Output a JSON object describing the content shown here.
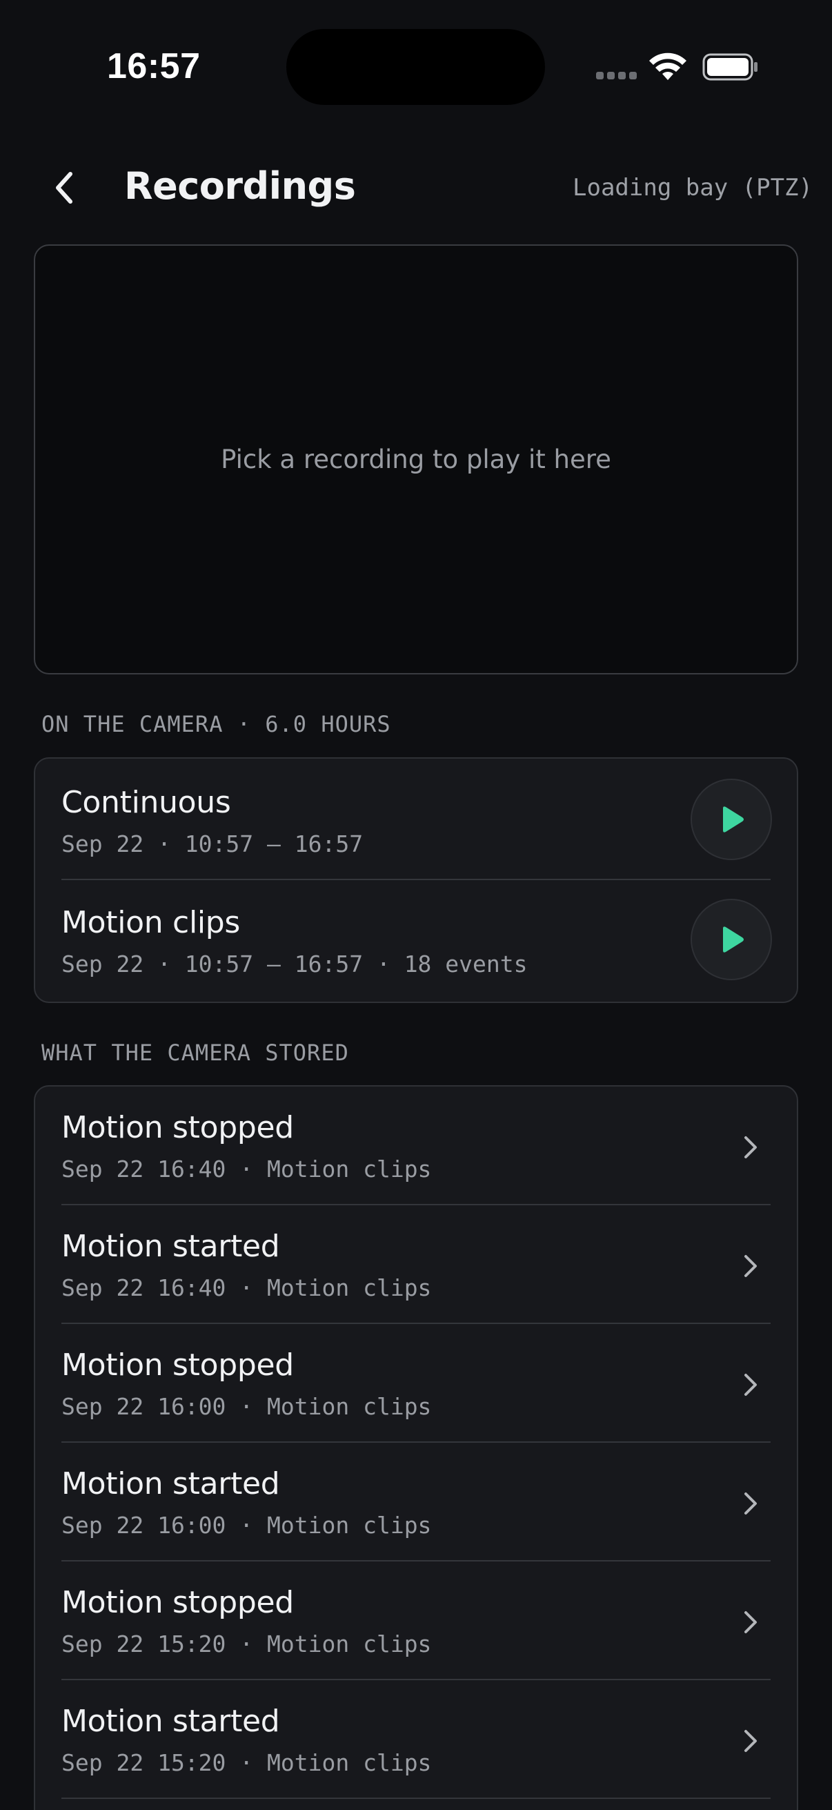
{
  "status_bar": {
    "time": "16:57"
  },
  "header": {
    "title": "Recordings",
    "camera_name": "Loading bay (PTZ)"
  },
  "player": {
    "hint": "Pick a recording to play it here"
  },
  "on_camera": {
    "section_label": "ON THE CAMERA · 6.0 HOURS",
    "items": [
      {
        "title": "Continuous",
        "subtitle": "Sep 22 · 10:57 – 16:57"
      },
      {
        "title": "Motion clips",
        "subtitle": "Sep 22 · 10:57 – 16:57 · 18 events"
      }
    ]
  },
  "stored": {
    "section_label": "WHAT THE CAMERA STORED",
    "items": [
      {
        "title": "Motion stopped",
        "subtitle": "Sep 22 16:40 · Motion clips"
      },
      {
        "title": "Motion started",
        "subtitle": "Sep 22 16:40 · Motion clips"
      },
      {
        "title": "Motion stopped",
        "subtitle": "Sep 22 16:00 · Motion clips"
      },
      {
        "title": "Motion started",
        "subtitle": "Sep 22 16:00 · Motion clips"
      },
      {
        "title": "Motion stopped",
        "subtitle": "Sep 22 15:20 · Motion clips"
      },
      {
        "title": "Motion started",
        "subtitle": "Sep 22 15:20 · Motion clips"
      }
    ]
  },
  "colors": {
    "background": "#0e0f12",
    "card": "#17181c",
    "accent_play": "#3ed6a0",
    "text_primary": "#f1f2f4",
    "text_secondary": "#9a9da3"
  },
  "icons": {
    "back": "chevron-left-icon",
    "play": "play-icon",
    "row_chevron": "chevron-right-icon",
    "wifi": "wifi-icon",
    "battery": "battery-icon",
    "signal": "signal-dots-icon"
  }
}
